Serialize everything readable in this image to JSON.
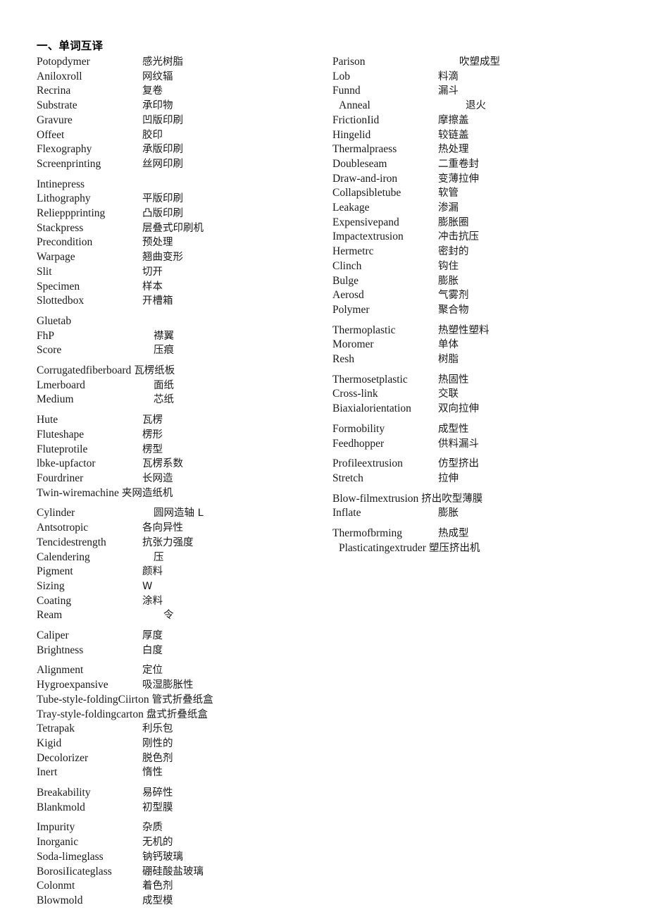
{
  "document": {
    "title": "一、单词互译"
  },
  "left_column": {
    "groups": [
      {
        "entries": [
          {
            "term": "Potopdymer",
            "gloss": "感光树脂"
          },
          {
            "term": "Aniloxroll",
            "gloss": "网纹辐"
          },
          {
            "term": "Recrina",
            "gloss": "复卷"
          },
          {
            "term": "Substrate",
            "gloss": "承印物"
          },
          {
            "term": "Gravure",
            "gloss": "凹版印刷"
          },
          {
            "term": "Offeet",
            "gloss": "胶印"
          },
          {
            "term": "Flexography",
            "gloss": "承版印刷"
          },
          {
            "term": "Screenprinting",
            "gloss": "丝网印刷"
          }
        ]
      },
      {
        "entries": [
          {
            "term": "Intinepress",
            "gloss": ""
          },
          {
            "term": "Lithography",
            "gloss": "平版印刷"
          },
          {
            "term": "Relieppprinting",
            "gloss": "凸版印刷"
          },
          {
            "term": "Stackpress",
            "gloss": "层叠式印刷机"
          },
          {
            "term": "Precondition",
            "gloss": "预处理"
          },
          {
            "term": "Warpage",
            "gloss": "翘曲变形"
          },
          {
            "term": "Slit",
            "gloss": "切开"
          },
          {
            "term": "Specimen",
            "gloss": "样本"
          },
          {
            "term": "Slottedbox",
            "gloss": "开槽箱"
          }
        ]
      },
      {
        "entries": [
          {
            "term": "Gluetab",
            "gloss": ""
          },
          {
            "term": "FhP",
            "gloss": "襟翼",
            "gloss_indent": 1
          },
          {
            "term": "Score",
            "gloss": "压痕",
            "gloss_indent": 1
          }
        ]
      },
      {
        "entries": [
          {
            "term": "Corrugatedfiberboard",
            "gloss": "瓦楞纸板",
            "wide": true
          },
          {
            "term": "Lmerboard",
            "gloss": "面纸",
            "gloss_indent": 1
          },
          {
            "term": "Medium",
            "gloss": "芯纸",
            "gloss_indent": 1
          }
        ]
      },
      {
        "entries": [
          {
            "term": "Hute",
            "gloss": "瓦楞"
          },
          {
            "term": "Fluteshape",
            "gloss": "楞形"
          },
          {
            "term": "Fluteprotile",
            "gloss": "楞型"
          },
          {
            "term": "lbke-upfactor",
            "gloss": "瓦楞系数"
          },
          {
            "term": "Fourdriner",
            "gloss": "长网造"
          },
          {
            "term": "Twin-wiremachine",
            "gloss": "夹网造纸机",
            "wide": true
          }
        ]
      },
      {
        "entries": [
          {
            "term": "Cylinder",
            "gloss": "圆网造轴 L",
            "gloss_indent": 1
          },
          {
            "term": "Antsotropic",
            "gloss": "各向异性"
          },
          {
            "term": "Tencidestrength",
            "gloss": "抗张力强度"
          },
          {
            "term": "Calendering",
            "gloss": "压",
            "gloss_indent": 1
          },
          {
            "term": "Pigment",
            "gloss": "颜料"
          },
          {
            "term": "Sizing",
            "gloss": "W"
          },
          {
            "term": "Coating",
            "gloss": "涂料"
          },
          {
            "term": "Ream",
            "gloss": "令",
            "gloss_indent": 2
          }
        ]
      },
      {
        "entries": [
          {
            "term": "Caliper",
            "gloss": "厚度"
          },
          {
            "term": "Brightness",
            "gloss": "白度"
          }
        ]
      },
      {
        "entries": [
          {
            "term": "Alignment",
            "gloss": "定位"
          },
          {
            "term": "Hygroexpansive",
            "gloss": "吸湿膨胀性"
          },
          {
            "term": "Tube-style-foldingCiirton",
            "gloss": "管式折叠纸盒",
            "wide": true
          },
          {
            "term": "Tray-style-foldingcarton",
            "gloss": "盘式折叠纸盒",
            "wide": true
          },
          {
            "term": "Tetrapak",
            "gloss": "利乐包"
          },
          {
            "term": "Kigid",
            "gloss": "刚性的"
          },
          {
            "term": "Decolorizer",
            "gloss": "脱色剂"
          },
          {
            "term": "Inert",
            "gloss": "惰性"
          }
        ]
      },
      {
        "entries": [
          {
            "term": "Breakability",
            "gloss": "易碎性"
          },
          {
            "term": "Blankmold",
            "gloss": "初型膜"
          }
        ]
      },
      {
        "entries": [
          {
            "term": "Impurity",
            "gloss": "杂质"
          },
          {
            "term": "Inorganic",
            "gloss": "无机的"
          },
          {
            "term": "Soda-limeglass",
            "gloss": "钠钙玻璃"
          },
          {
            "term": "BorosiIicateglass",
            "gloss": "硼硅酸盐玻璃"
          },
          {
            "term": "Colonmt",
            "gloss": "着色剂"
          },
          {
            "term": "Blowmold",
            "gloss": "成型模"
          }
        ]
      }
    ]
  },
  "right_column": {
    "groups": [
      {
        "entries": [
          {
            "term": "Parison",
            "gloss": "吹塑成型",
            "gloss_indent": 2
          },
          {
            "term": "Lob",
            "gloss": "料滴"
          },
          {
            "term": "Funnd",
            "gloss": "漏斗"
          },
          {
            "term": "Anneal",
            "gloss": "退火",
            "gloss_indent": 2,
            "term_indent": true
          },
          {
            "term": "FrictionIid",
            "gloss": "摩擦盖"
          },
          {
            "term": "Hingelid",
            "gloss": "较链盖"
          },
          {
            "term": "Thermalpraess",
            "gloss": "热处理"
          },
          {
            "term": "Doubleseam",
            "gloss": "二重卷封"
          },
          {
            "term": "Draw-and-iron",
            "gloss": "变薄拉伸"
          },
          {
            "term": "Collapsibletube",
            "gloss": "软管"
          },
          {
            "term": "Leakage",
            "gloss": "渗漏"
          },
          {
            "term": "Expensivepand",
            "gloss": "膨胀圈"
          },
          {
            "term": "Impactextrusion",
            "gloss": "冲击抗压"
          },
          {
            "term": "Hermetrc",
            "gloss": "密封的"
          },
          {
            "term": "Clinch",
            "gloss": "钩住"
          },
          {
            "term": "Bulge",
            "gloss": "膨胀"
          },
          {
            "term": "Aerosd",
            "gloss": "气雾剂"
          },
          {
            "term": "Polymer",
            "gloss": "聚合物"
          }
        ]
      },
      {
        "entries": [
          {
            "term": "Thermoplastic",
            "gloss": "热塑性塑料"
          },
          {
            "term": "Moromer",
            "gloss": "单体"
          },
          {
            "term": "Resh",
            "gloss": "树脂"
          }
        ]
      },
      {
        "entries": [
          {
            "term": "Thermosetplastic",
            "gloss": "热固性"
          },
          {
            "term": "Cross-link",
            "gloss": "交联"
          },
          {
            "term": "Biaxialorientation",
            "gloss": "双向拉伸"
          }
        ]
      },
      {
        "entries": [
          {
            "term": "Formobility",
            "gloss": "成型性"
          },
          {
            "term": "Feedhopper",
            "gloss": "供料漏斗"
          }
        ]
      },
      {
        "entries": [
          {
            "term": "Profileextrusion",
            "gloss": "仿型挤出"
          },
          {
            "term": "Stretch",
            "gloss": "拉伸"
          }
        ]
      },
      {
        "entries": [
          {
            "term": "Blow-filmextrusion",
            "gloss": "挤出吹型薄膜",
            "wide": true
          },
          {
            "term": "Inflate",
            "gloss": "膨胀"
          }
        ]
      },
      {
        "entries": [
          {
            "term": "Thermofbrming",
            "gloss": "热成型"
          },
          {
            "term": "Plasticatingextruder",
            "gloss": "塑压挤出机",
            "wide": true,
            "term_indent": true
          }
        ]
      }
    ]
  }
}
